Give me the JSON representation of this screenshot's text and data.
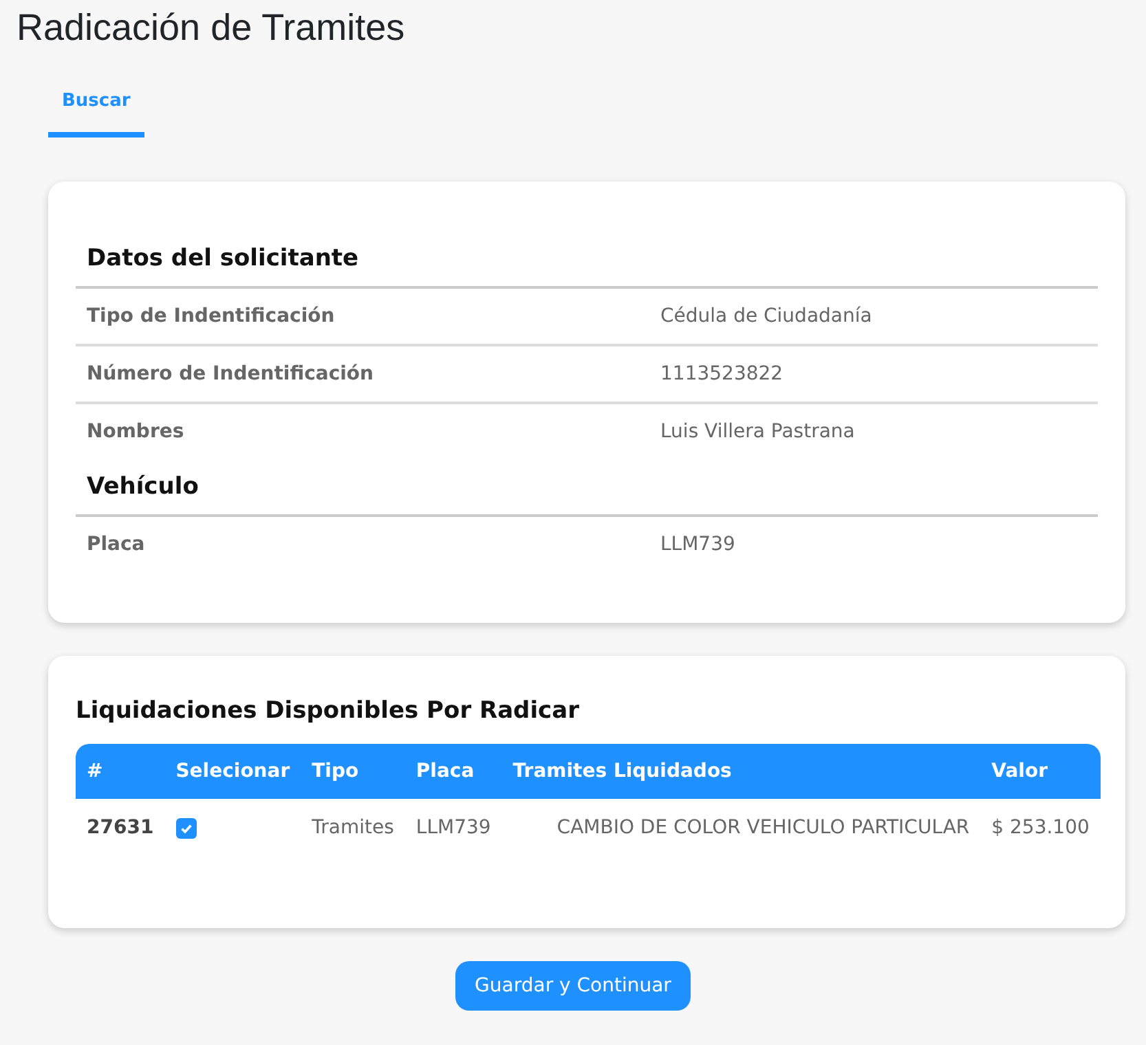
{
  "page": {
    "title": "Radicación de Tramites"
  },
  "tabs": [
    {
      "label": "Buscar",
      "selected": true
    }
  ],
  "details": {
    "sections": [
      {
        "heading": "Datos del solicitante",
        "rows": [
          {
            "label": "Tipo de Indentificación",
            "value": "Cédula de Ciudadanía"
          },
          {
            "label": "Número de Indentificación",
            "value": "1113523822"
          },
          {
            "label": "Nombres",
            "value": "Luis Villera Pastrana"
          }
        ]
      },
      {
        "heading": "Vehículo",
        "rows": [
          {
            "label": "Placa",
            "value": "LLM739"
          }
        ]
      }
    ]
  },
  "liquidaciones": {
    "title": "Liquidaciones Disponibles Por Radicar",
    "columns": [
      "#",
      "Selecionar",
      "Tipo",
      "Placa",
      "Tramites Liquidados",
      "Valor"
    ],
    "rows": [
      {
        "number": "27631",
        "checked": true,
        "tipo": "Tramites",
        "placa": "LLM739",
        "tramites": "CAMBIO DE COLOR VEHICULO PARTICULAR",
        "valor": "$ 253.100"
      }
    ]
  },
  "button": "Guardar y Continuar"
}
